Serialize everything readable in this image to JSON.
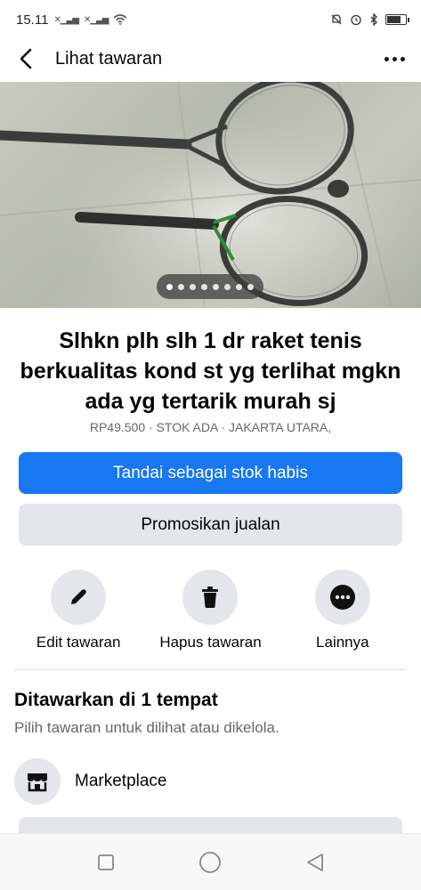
{
  "status_bar": {
    "time": "15.11",
    "signal_icons": [
      "signal-x-icon",
      "signal-x-icon",
      "wifi-icon"
    ],
    "right_icons": [
      "mute-icon",
      "alarm-icon",
      "bluetooth-icon",
      "battery-icon"
    ],
    "battery_level": 0.8
  },
  "header": {
    "title": "Lihat tawaran",
    "back_icon": "chevron-left-icon",
    "more_icon": "more-horizontal-icon"
  },
  "photo": {
    "description_icon": "product-photo",
    "page_count": 8,
    "current_page": 1
  },
  "listing": {
    "title": "Slhkn plh slh 1 dr raket tenis berkualitas kond st yg terlihat mgkn ada yg tertarik murah sj",
    "meta": "RP49.500 · STOK ADA · JAKARTA UTARA,"
  },
  "buttons": {
    "mark_sold": "Tandai sebagai stok habis",
    "promote": "Promosikan jualan"
  },
  "actions": [
    {
      "label": "Edit tawaran",
      "icon": "pencil-icon"
    },
    {
      "label": "Hapus tawaran",
      "icon": "trash-icon"
    },
    {
      "label": "Lainnya",
      "icon": "more-circle-icon"
    }
  ],
  "offered": {
    "title": "Ditawarkan di 1 tempat",
    "subtitle": "Pilih tawaran untuk dilihat atau dikelola.",
    "places": [
      {
        "label": "Marketplace",
        "icon": "marketplace-shop-icon"
      }
    ]
  },
  "colors": {
    "primary": "#1877f2",
    "secondary_bg": "#e4e6eb",
    "muted_text": "#65676b"
  },
  "nav": {
    "buttons": [
      "recents-square-icon",
      "home-circle-icon",
      "back-triangle-icon"
    ]
  }
}
